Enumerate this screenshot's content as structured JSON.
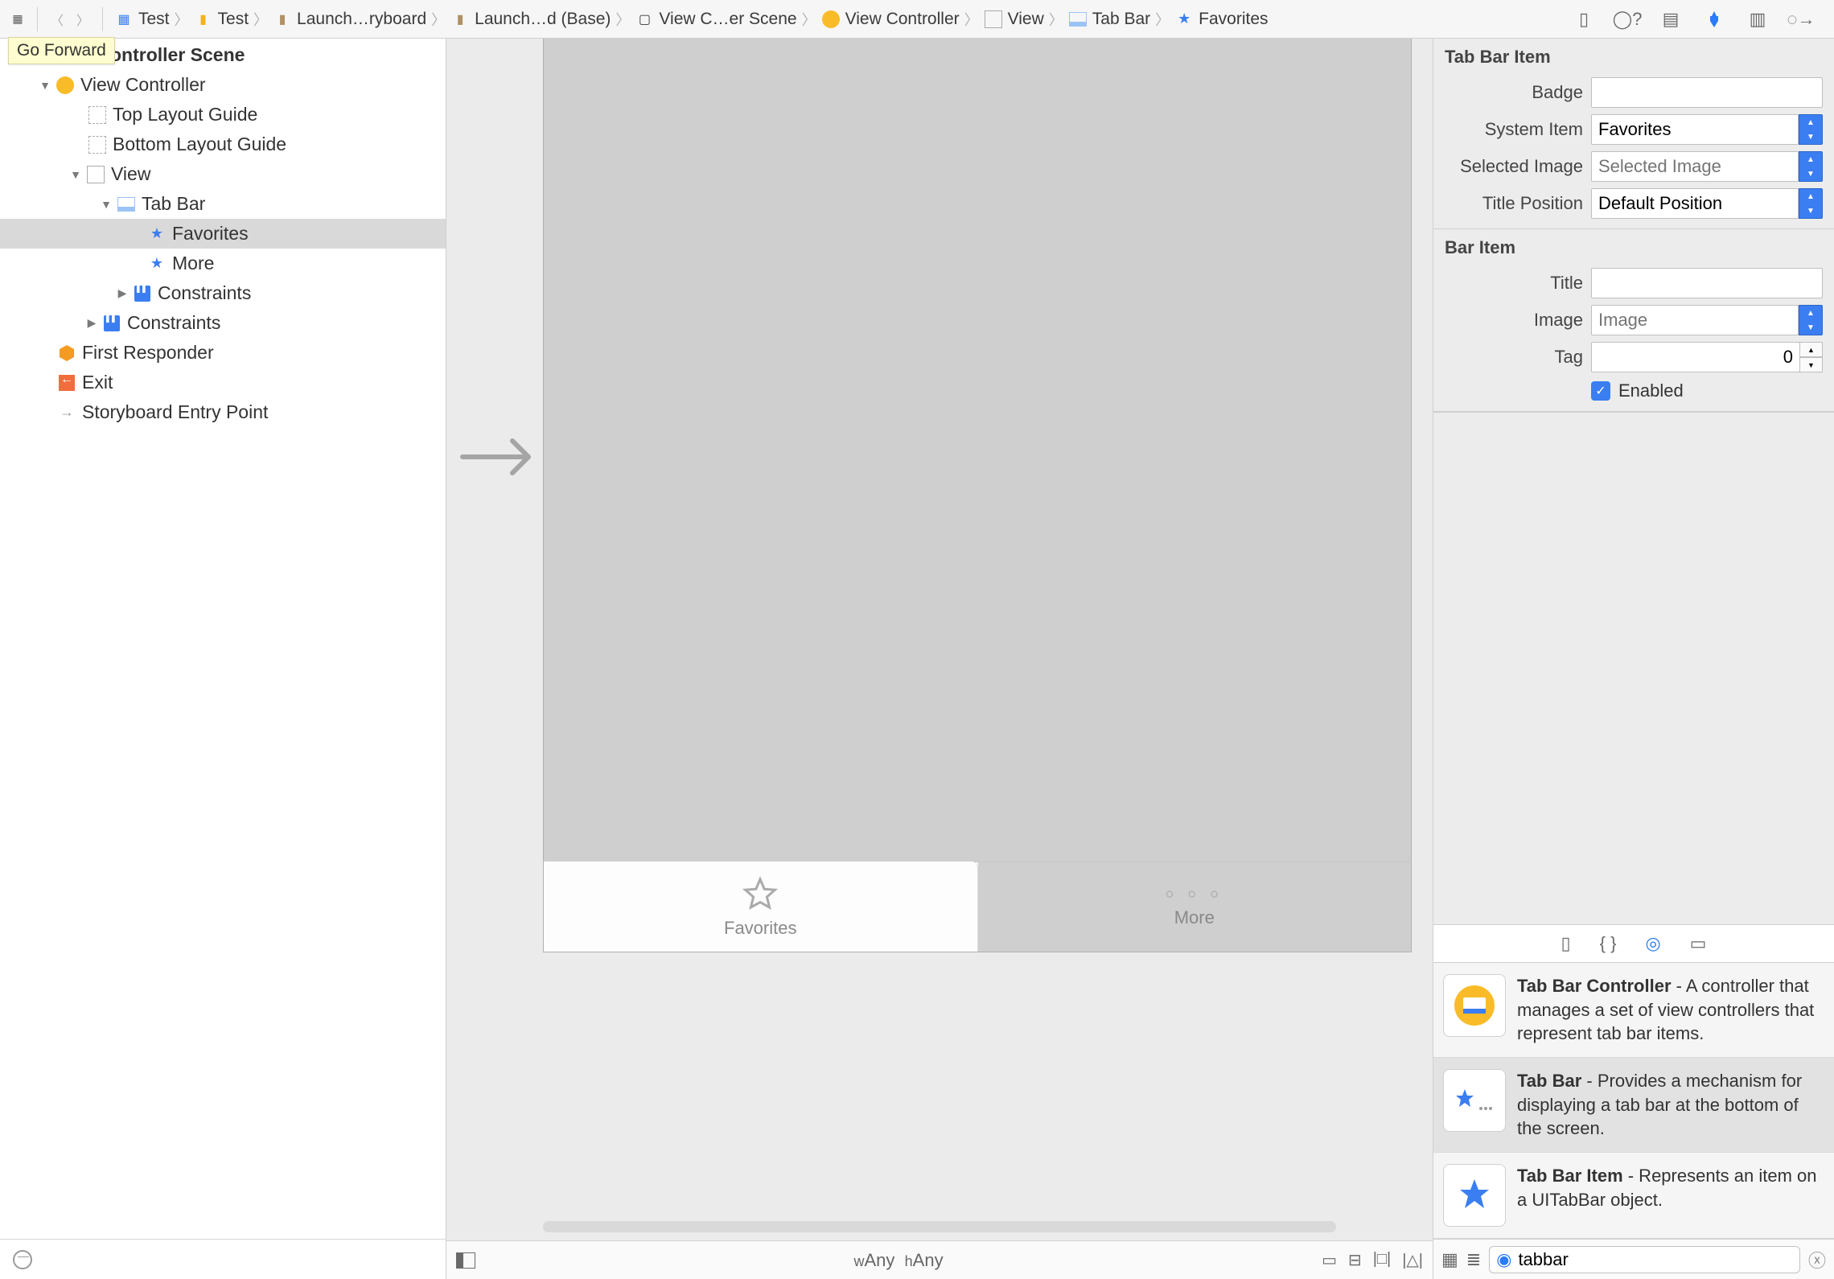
{
  "tooltip": "Go Forward",
  "breadcrumb": [
    {
      "icon": "image",
      "label": "Test"
    },
    {
      "icon": "folder",
      "label": "Test"
    },
    {
      "icon": "storyboard",
      "label": "Launch…ryboard"
    },
    {
      "icon": "storyboard",
      "label": "Launch…d (Base)"
    },
    {
      "icon": "scene",
      "label": "View C…er Scene"
    },
    {
      "icon": "vc",
      "label": "View Controller"
    },
    {
      "icon": "view",
      "label": "View"
    },
    {
      "icon": "tabbar",
      "label": "Tab Bar"
    },
    {
      "icon": "star",
      "label": "Favorites"
    }
  ],
  "outline": {
    "title": "View Controller Scene",
    "vc": "View Controller",
    "top_guide": "Top Layout Guide",
    "bottom_guide": "Bottom Layout Guide",
    "view": "View",
    "tabbar": "Tab Bar",
    "favorites": "Favorites",
    "more": "More",
    "constraints_inner": "Constraints",
    "constraints": "Constraints",
    "first_responder": "First Responder",
    "exit": "Exit",
    "entry": "Storyboard Entry Point"
  },
  "canvas": {
    "tab_fav": "Favorites",
    "tab_more": "More",
    "size_class_w": "w",
    "size_class_any_w": "Any",
    "size_class_h": "h",
    "size_class_any_h": "Any"
  },
  "inspector": {
    "tabbaritem_header": "Tab Bar Item",
    "badge_label": "Badge",
    "badge_value": "",
    "system_item_label": "System Item",
    "system_item_value": "Favorites",
    "selected_image_label": "Selected Image",
    "selected_image_placeholder": "Selected Image",
    "title_position_label": "Title Position",
    "title_position_value": "Default Position",
    "baritem_header": "Bar Item",
    "title_label": "Title",
    "title_value": "",
    "image_label": "Image",
    "image_placeholder": "Image",
    "tag_label": "Tag",
    "tag_value": "0",
    "enabled_label": "Enabled"
  },
  "library": {
    "items": [
      {
        "title": "Tab Bar Controller",
        "desc": " - A controller that manages a set of view controllers that represent tab bar items."
      },
      {
        "title": "Tab Bar",
        "desc": " - Provides a mechanism for displaying a tab bar at the bottom of the screen."
      },
      {
        "title": "Tab Bar Item",
        "desc": " - Represents an item on a UITabBar object."
      }
    ],
    "search_value": "tabbar"
  }
}
